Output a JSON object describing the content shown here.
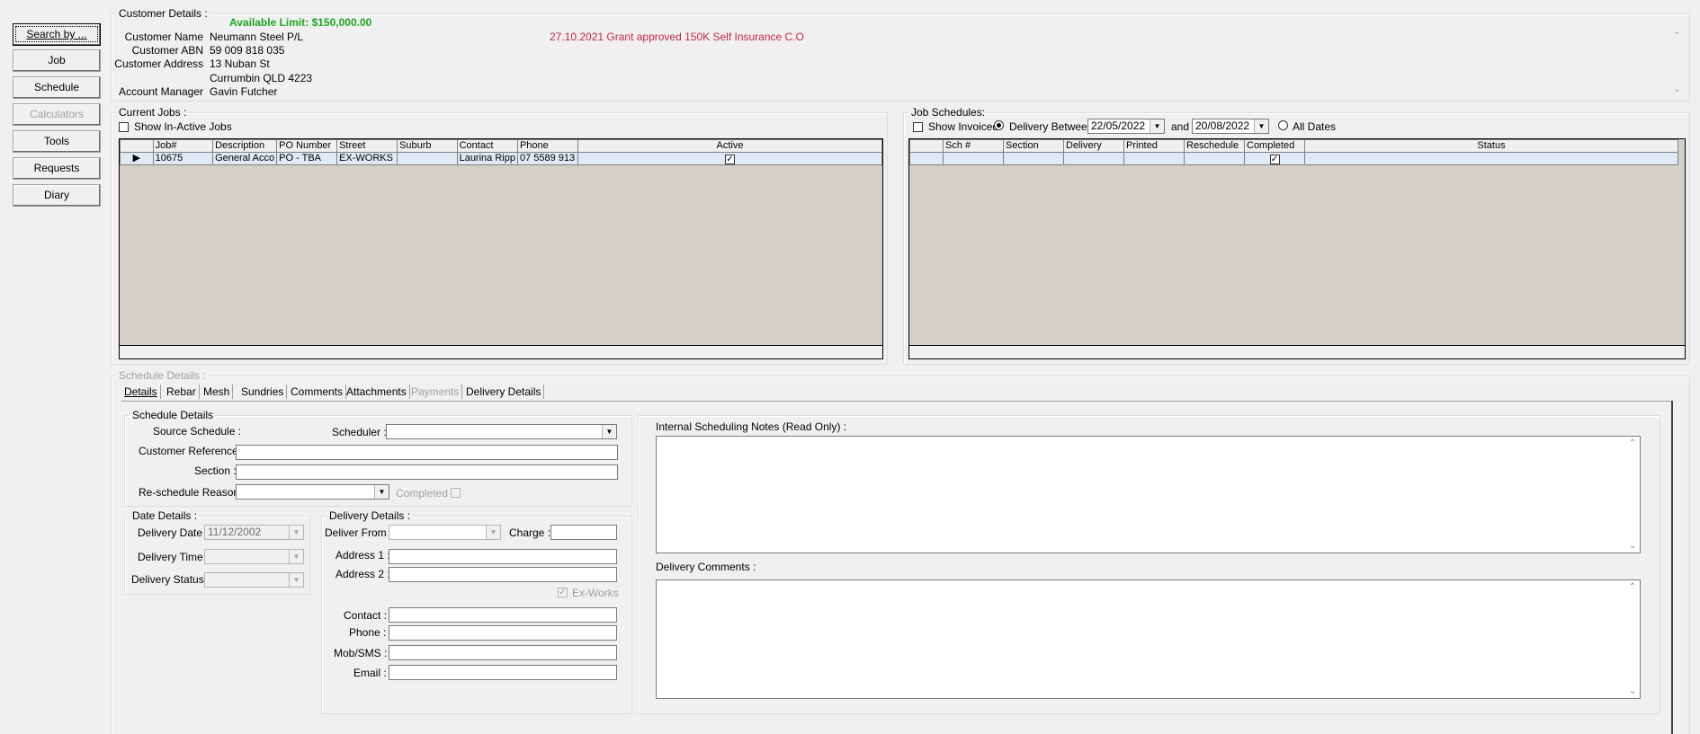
{
  "nav": {
    "search": "Search by ...",
    "job": "Job",
    "schedule": "Schedule",
    "calculators": "Calculators",
    "tools": "Tools",
    "requests": "Requests",
    "diary": "Diary"
  },
  "customer": {
    "legend": "Customer Details :",
    "available_limit": "Available Limit: $150,000.00",
    "note": "27.10.2021 Grant approved 150K Self Insurance C.O",
    "name_label": "Customer Name",
    "name": "Neumann Steel P/L",
    "abn_label": "Customer ABN",
    "abn": "59 009 818 035",
    "address_label": "Customer Address",
    "address1": "13 Nuban St",
    "address2": "Currumbin QLD 4223",
    "manager_label": "Account Manager",
    "manager": "Gavin Futcher"
  },
  "current_jobs": {
    "legend": "Current Jobs :",
    "show_inactive": "Show In-Active Jobs",
    "columns": [
      "Job#",
      "Description",
      "PO Number",
      "Street",
      "Suburb",
      "Contact",
      "Phone",
      "Active"
    ],
    "rows": [
      {
        "job": "10675",
        "description": "General Acco",
        "po": "PO - TBA",
        "street": "EX-WORKS",
        "suburb": "",
        "contact": "Laurina Ripp",
        "phone": "07 5589 913",
        "active": true
      }
    ]
  },
  "job_schedules": {
    "legend": "Job Schedules:",
    "show_invoiced": "Show Invoiced",
    "delivery_between": "Delivery Between",
    "date_from": "22/05/2022",
    "and": "and",
    "date_to": "20/08/2022",
    "all_dates": "All Dates",
    "columns": [
      "Sch #",
      "Section",
      "Delivery",
      "Printed",
      "Reschedule",
      "Completed",
      "Status"
    ],
    "rows": [
      {
        "sch": "",
        "section": "",
        "delivery": "",
        "printed": "",
        "reschedule": "",
        "completed": true,
        "status": ""
      }
    ]
  },
  "schedule_details": {
    "legend": "Schedule Details :",
    "tabs": [
      "Details",
      "Rebar",
      "Mesh",
      "Sundries",
      "Comments",
      "Attachments",
      "Payments",
      "Delivery Details"
    ],
    "inner_legend": "Schedule Details",
    "source_schedule": "Source Schedule :",
    "scheduler": "Scheduler :",
    "customer_reference": "Customer Reference :",
    "section": "Section :",
    "reschedule_reason": "Re-schedule Reason:",
    "completed": "Completed :"
  },
  "date_details": {
    "legend": "Date Details :",
    "delivery_date_label": "Delivery Date :",
    "delivery_date": "11/12/2002",
    "delivery_time_label": "Delivery Time :",
    "delivery_status_label": "Delivery Status :"
  },
  "delivery_details": {
    "legend": "Delivery Details :",
    "deliver_from": "Deliver From :",
    "charge": "Charge :",
    "address1": "Address 1 :",
    "address2": "Address 2 :",
    "ex_works": "Ex-Works",
    "contact": "Contact :",
    "phone": "Phone :",
    "mob": "Mob/SMS :",
    "email": "Email :"
  },
  "notes": {
    "internal_label": "Internal Scheduling Notes (Read Only) :",
    "delivery_comments_label": "Delivery Comments :"
  }
}
